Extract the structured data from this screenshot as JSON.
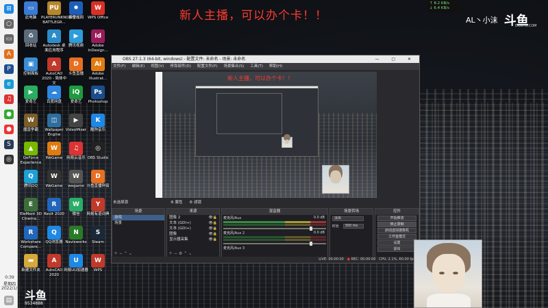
{
  "stream_banner": "新人主播，可以办个卡！！",
  "net_speed": {
    "up": "↑ 8.2 KB/s",
    "down": "↓ 6.4 KB/s"
  },
  "douyu": {
    "user": "AL丶小沫",
    "logo": "斗鱼",
    "url": "DOUYU.COM",
    "room_number": "9534888"
  },
  "taskbar": {
    "time": "0:39",
    "weekday": "星期四",
    "date": "2022/1/15",
    "icons": [
      {
        "name": "windows-icon",
        "glyph": "⊞",
        "color": "#1e88e5"
      },
      {
        "name": "search-icon",
        "glyph": "○",
        "color": "#666"
      },
      {
        "name": "task-view-icon",
        "glyph": "▭",
        "color": "#666"
      },
      {
        "name": "ai-icon",
        "glyph": "A",
        "color": "#e0701b"
      },
      {
        "name": "ps-icon",
        "glyph": "P",
        "color": "#1d4e8f"
      },
      {
        "name": "edge-icon",
        "glyph": "e",
        "color": "#1a9ad6"
      },
      {
        "name": "netease-icon",
        "glyph": "♫",
        "color": "#d33"
      },
      {
        "name": "green-app-icon",
        "glyph": "●",
        "color": "#3a3"
      },
      {
        "name": "orange-app-icon",
        "glyph": "●",
        "color": "#e33"
      },
      {
        "name": "steam-icon",
        "glyph": "S",
        "color": "#2a3b55"
      },
      {
        "name": "obs-icon",
        "glyph": "◎",
        "color": "#333"
      }
    ]
  },
  "desktop_icons": [
    {
      "label": "此电脑",
      "glyph": "▭",
      "color": "#3a7bd5"
    },
    {
      "label": "PLAYERUNKNOWN'S BATTLEGR...",
      "glyph": "PU",
      "color": "#b8862b"
    },
    {
      "label": "暴雪战网",
      "glyph": "✹",
      "color": "#1c5fb8"
    },
    {
      "label": "WPS Office",
      "glyph": "W",
      "color": "#d93025"
    },
    {
      "label": "回收站",
      "glyph": "♻",
      "color": "#5a6b7c"
    },
    {
      "label": "Autodesk 桌面应用程序",
      "glyph": "A",
      "color": "#2c8cc9"
    },
    {
      "label": "腾讯视频",
      "glyph": "▶",
      "color": "#2d9cdb"
    },
    {
      "label": "Adobe InDesign...",
      "glyph": "Id",
      "color": "#9a1b5a"
    },
    {
      "label": "控制面板",
      "glyph": "▣",
      "color": "#3b8ed6"
    },
    {
      "label": "AutoCAD 2020 - 简体中文",
      "glyph": "A",
      "color": "#c0392b"
    },
    {
      "label": "斗鱼直播",
      "glyph": "D",
      "color": "#e76f22"
    },
    {
      "label": "Adobe Illustrat...",
      "glyph": "Ai",
      "color": "#e07b12"
    },
    {
      "label": "爱奇艺",
      "glyph": "▶",
      "color": "#27ae60"
    },
    {
      "label": "百度网盘",
      "glyph": "☁",
      "color": "#2e86de"
    },
    {
      "label": "爱奇艺",
      "glyph": "iQ",
      "color": "#1e9b3f"
    },
    {
      "label": "Photoshop",
      "glyph": "Ps",
      "color": "#1a4d8c"
    },
    {
      "label": "魔兽争霸",
      "glyph": "W",
      "color": "#7b5d2a"
    },
    {
      "label": "Wallpaper Engine",
      "glyph": "◫",
      "color": "#2d6e9e"
    },
    {
      "label": "VideoMixer",
      "glyph": "▶",
      "color": "#444"
    },
    {
      "label": "酷狗音乐",
      "glyph": "K",
      "color": "#1e88e5"
    },
    {
      "label": "GeForce Experience",
      "glyph": "▲",
      "color": "#76b900"
    },
    {
      "label": "WeGame",
      "glyph": "W",
      "color": "#e07b12"
    },
    {
      "label": "网易云音乐",
      "glyph": "♫",
      "color": "#d33"
    },
    {
      "label": "OBS Studio",
      "glyph": "◎",
      "color": "#222"
    },
    {
      "label": "腾讯QQ",
      "glyph": "Q",
      "color": "#1ea0d6"
    },
    {
      "label": "WeGame",
      "glyph": "W",
      "color": "#333"
    },
    {
      "label": "wegame",
      "glyph": "W",
      "color": "#555"
    },
    {
      "label": "斗鱼直播伴侣",
      "glyph": "D",
      "color": "#e76f22"
    },
    {
      "label": "EleMent 3D Cinema...",
      "glyph": "E",
      "color": "#3c6e3c"
    },
    {
      "label": "Revit 2020",
      "glyph": "R",
      "color": "#2266bb"
    },
    {
      "label": "微信",
      "glyph": "W",
      "color": "#2aae67"
    },
    {
      "label": "网易有道词典",
      "glyph": "Y",
      "color": "#c0392b"
    },
    {
      "label": "Workshare Compare...",
      "glyph": "R",
      "color": "#2266bb"
    },
    {
      "label": "QQ浏览器",
      "glyph": "Q",
      "color": "#1e88e5"
    },
    {
      "label": "Navisworks",
      "glyph": "N",
      "color": "#2a7a2a"
    },
    {
      "label": "Steam",
      "glyph": "S",
      "color": "#1b2838"
    },
    {
      "label": "新建文件夹",
      "glyph": "▬",
      "color": "#d6a93a"
    },
    {
      "label": "AutoCAD 2020",
      "glyph": "A",
      "color": "#c0392b"
    },
    {
      "label": "网易UU加速器",
      "glyph": "U",
      "color": "#1e88e5"
    },
    {
      "label": "WPS",
      "glyph": "W",
      "color": "#c0392b"
    }
  ],
  "obs": {
    "title": "OBS 27.1.3 (64-bit, windows) - 配置文件: 未命名 - 场景: 未命名",
    "window_controls": "— ▢ ✕",
    "menu": [
      "文件(F)",
      "编辑(E)",
      "视图(V)",
      "停靠部件(D)",
      "配置文件(P)",
      "场景集合(S)",
      "工具(T)",
      "帮助(H)"
    ],
    "preview_banner": "新人主播，可以办个卡！！",
    "no_source_label": "未选择源",
    "properties_btn": "⚙ 属性",
    "filters_btn": "⚙ 滤镜",
    "scenes": {
      "header": "场景",
      "items": [
        "游戏",
        "场景"
      ]
    },
    "sources": {
      "header": "来源",
      "items": [
        "图像 2",
        "文本 (GDI+)",
        "文本 (GDI+)",
        "图像",
        "显示器采集"
      ]
    },
    "mixer": {
      "header": "混音器",
      "channels": [
        {
          "name": "麦克风/Aux",
          "db": "0.0 dB"
        },
        {
          "name": "麦克风/Aux 2",
          "db": "0.0 dB"
        },
        {
          "name": "麦克风/Aux 3",
          "db": ""
        }
      ]
    },
    "transitions": {
      "header": "场景转场",
      "type": "淡出",
      "duration_label": "时长",
      "duration": "300 ms"
    },
    "controls": {
      "header": "控件",
      "buttons": [
        "开始推流",
        "停止录制",
        "启动虚拟摄像机",
        "工作室模式",
        "设置",
        "退出"
      ]
    },
    "status": {
      "live": "LIVE: 00:00:00",
      "rec": "REC: 00:00:00",
      "cpu": "CPU: 2.1%, 60.00 fps"
    }
  }
}
